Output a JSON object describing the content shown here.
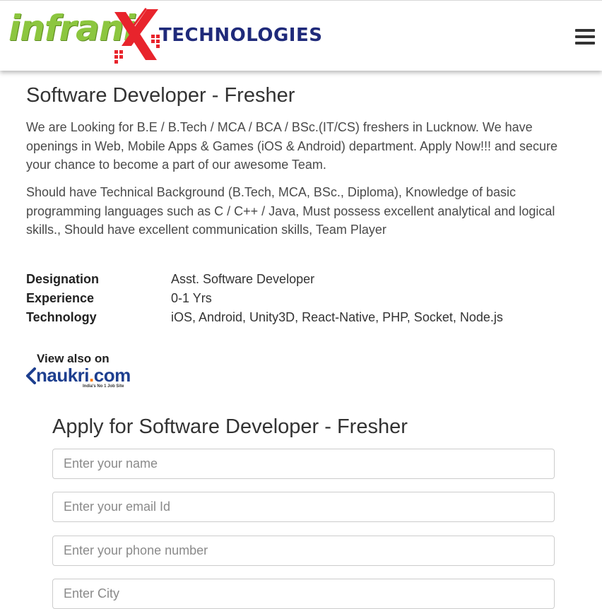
{
  "header": {
    "logo_word": "infrani",
    "logo_tagline": "TECHNOLOGIES",
    "menu_icon": "hamburger-menu-icon",
    "colors": {
      "logo_green": "#8cc63f",
      "logo_red": "#e8242c",
      "tagline_navy": "#1f2a7a"
    }
  },
  "job": {
    "title": "Software Developer - Fresher",
    "intro": "We are Looking for B.E / B.Tech / MCA / BCA / BSc.(IT/CS) freshers in Lucknow. We have openings in Web, Mobile Apps & Games (iOS & Android) department. Apply Now!!! and secure your chance to become a part of our awesome Team.",
    "requirements": " Should have Technical Background (B.Tech, MCA, BSc., Diploma), Knowledge of basic programming languages such as C / C++ / Java, Must possess excellent analytical and logical skills., Should have excellent communication skills, Team Player",
    "details": [
      {
        "label": "Designation",
        "value": "Asst. Software Developer"
      },
      {
        "label": "Experience",
        "value": "0-1 Yrs"
      },
      {
        "label": "Technology",
        "value": "iOS, Android, Unity3D, React-Native, PHP, Socket, Node.js"
      }
    ]
  },
  "naukri": {
    "view_text": "View also on",
    "logo_main": "naukri",
    "logo_dot": ".",
    "logo_com": "com",
    "tagline": "India's No 1 Job Site"
  },
  "apply": {
    "title": "Apply for Software Developer - Fresher",
    "fields": {
      "name_placeholder": "Enter your name",
      "email_placeholder": "Enter your email Id",
      "phone_placeholder": "Enter your phone number",
      "city_placeholder": "Enter City"
    }
  }
}
